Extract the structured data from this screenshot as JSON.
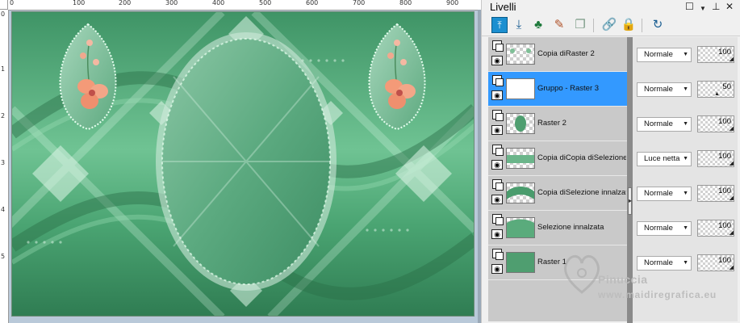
{
  "panel": {
    "title": "Livelli"
  },
  "ruler": {
    "top_labels": [
      "0",
      "100",
      "200",
      "300",
      "400",
      "500",
      "600",
      "700",
      "800",
      "900"
    ],
    "left_labels": [
      "0",
      "1",
      "2",
      "3",
      "4",
      "5"
    ]
  },
  "layers": [
    {
      "name": "Copia diRaster 2",
      "blend": "Normale",
      "opacity": "100",
      "selected": false
    },
    {
      "name": "Gruppo - Raster 3",
      "blend": "Normale",
      "opacity": "50",
      "selected": true
    },
    {
      "name": "Raster 2",
      "blend": "Normale",
      "opacity": "100",
      "selected": false
    },
    {
      "name": "Copia diCopia diSelezione in",
      "blend": "Luce netta",
      "opacity": "100",
      "selected": false
    },
    {
      "name": "Copia diSelezione innalzata",
      "blend": "Normale",
      "opacity": "100",
      "selected": false
    },
    {
      "name": "Selezione innalzata",
      "blend": "Normale",
      "opacity": "100",
      "selected": false
    },
    {
      "name": "Raster 1",
      "blend": "Normale",
      "opacity": "100",
      "selected": false
    }
  ],
  "watermark": {
    "name": "Pinuccia",
    "site": "www.maidiregrafica.eu"
  },
  "colors": {
    "selection": "#3399ff",
    "image_green": "#4fa276",
    "flower": "#f0a080"
  },
  "icons": [
    "move-layer-up-icon",
    "move-layer-down-icon",
    "new-layer-icon",
    "edit-icon",
    "duplicate-icon",
    "link-icon",
    "lock-icon",
    "refresh-icon"
  ]
}
